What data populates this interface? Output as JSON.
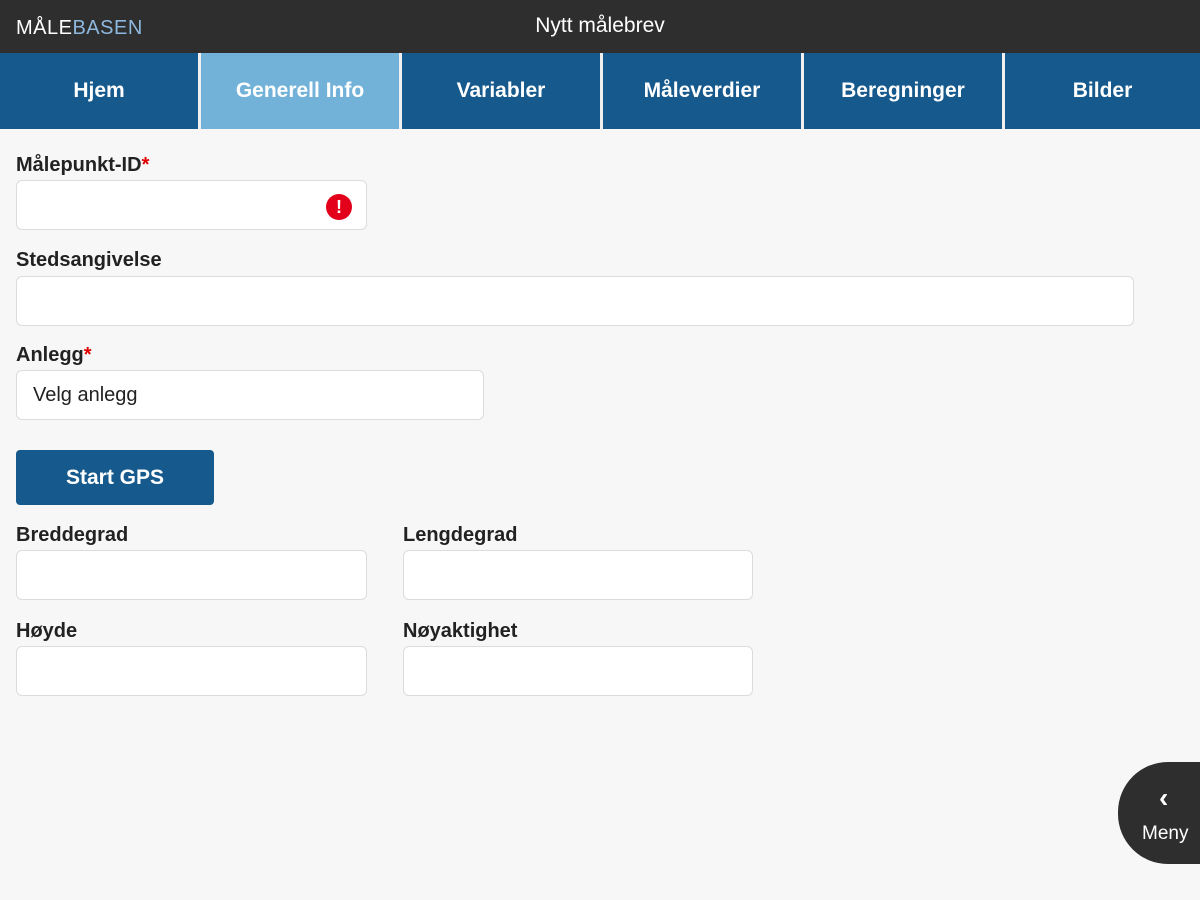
{
  "app": {
    "logo_part1": "MÅLE",
    "logo_part2": "BASEN",
    "title": "Nytt målebrev"
  },
  "tabs": [
    {
      "label": "Hjem"
    },
    {
      "label": "Generell Info",
      "active": true
    },
    {
      "label": "Variabler"
    },
    {
      "label": "Måleverdier"
    },
    {
      "label": "Beregninger"
    },
    {
      "label": "Bilder"
    }
  ],
  "form": {
    "malepunkt_label": "Målepunkt-ID",
    "required_mark": "*",
    "malepunkt_value": "",
    "error_icon": "!",
    "stedsangivelse_label": "Stedsangivelse",
    "stedsangivelse_value": "",
    "anlegg_label": "Anlegg",
    "anlegg_value": "Velg anlegg",
    "gps_button": "Start GPS",
    "breddegrad_label": "Breddegrad",
    "lengdegrad_label": "Lengdegrad",
    "hoyde_label": "Høyde",
    "noyaktighet_label": "Nøyaktighet"
  },
  "menu": {
    "icon": "chevron-left-icon",
    "chevron": "‹",
    "label": "Meny"
  },
  "colors": {
    "tab": "#16598c",
    "tab_active": "#72b2d9",
    "titlebar": "#2e2e2e",
    "error": "#e2001a"
  }
}
